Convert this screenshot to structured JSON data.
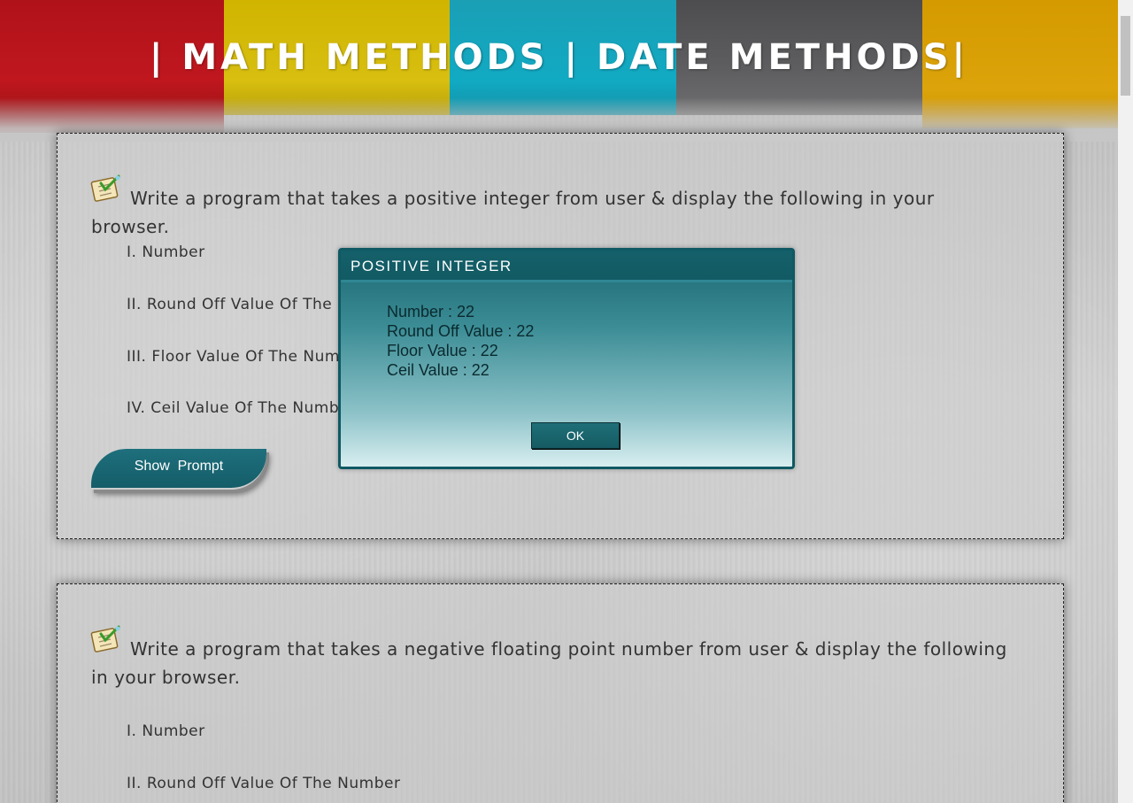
{
  "header": {
    "title": "| MATH METHODS | DATE METHODS|"
  },
  "card1": {
    "question": "Write a program that takes a positive integer from user & display the following in your browser.",
    "items": [
      "I. Number",
      "II. Round Off Value Of The Number",
      "III. Floor Value Of The Number",
      "IV. Ceil Value Of The Number"
    ],
    "button_label": "Show  Prompt"
  },
  "card2": {
    "question": "Write a program that takes a negative floating point number from user & display the following in your browser.",
    "items": [
      "I. Number",
      "II. Round Off Value Of The Number"
    ]
  },
  "dialog": {
    "title": "POSITIVE INTEGER",
    "lines": [
      "Number : 22",
      "Round Off Value : 22",
      "Floor Value : 22",
      "Ceil Value : 22"
    ],
    "ok_label": "OK"
  },
  "colors": {
    "accent": "#155d69",
    "stripe_red": "#c0171f",
    "stripe_yellow": "#d8bf10",
    "stripe_cyan": "#11aac3",
    "stripe_gray": "#5e5e60",
    "stripe_orange": "#dca40a"
  },
  "icons": {
    "task": "checklist-icon"
  }
}
